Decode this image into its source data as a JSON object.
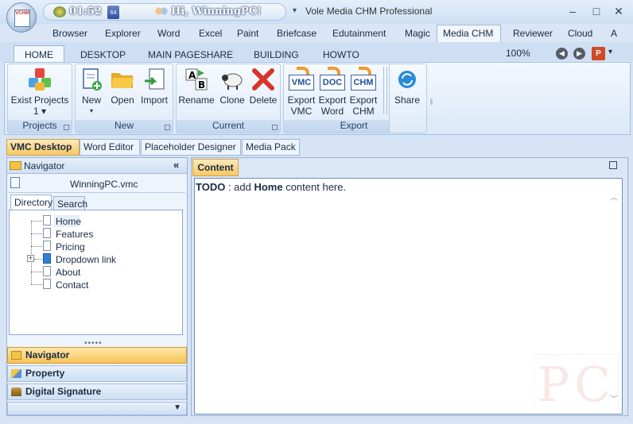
{
  "titlebar": {
    "time": "01:52",
    "user_greeting": "Hi, WinningPC!",
    "window_title": "Vole Media CHM Professional",
    "minimize": "–",
    "maximize": "□",
    "close": "✕",
    "logo_text": "VCHM"
  },
  "menu": {
    "items": [
      "Browser",
      "Explorer",
      "Word",
      "Excel",
      "Paint",
      "Briefcase",
      "Edutainment",
      "Magic",
      "Media CHM",
      "Reviewer",
      "Cloud",
      "A"
    ],
    "active": "Media CHM"
  },
  "ribbon_tabs": {
    "items": [
      "HOME",
      "DESKTOP",
      "MAIN PAGESHARE",
      "BUILDING",
      "HOWTO"
    ],
    "active": "HOME",
    "zoom": "100%"
  },
  "ribbon": {
    "groups": {
      "projects": {
        "label": "Projects",
        "exist_projects": "Exist Projects",
        "count": "1"
      },
      "new": {
        "label": "New",
        "new_label": "New",
        "open_label": "Open",
        "import_label": "Import"
      },
      "current": {
        "label": "Current",
        "rename_label": "Rename",
        "clone_label": "Clone",
        "delete_label": "Delete"
      },
      "export": {
        "label": "Export",
        "export_vmc": [
          "Export",
          "VMC"
        ],
        "export_word": [
          "Export",
          "Word"
        ],
        "export_chm": [
          "Export",
          "CHM"
        ],
        "icon_vmc": "VMC",
        "icon_doc": "DOC",
        "icon_chm": "CHM"
      },
      "share": {
        "share_label": "Share"
      }
    }
  },
  "doc_tabs": {
    "items": [
      "VMC Desktop",
      "Word Editor",
      "Placeholder Designer",
      "Media Pack"
    ],
    "active": "VMC Desktop"
  },
  "navigator": {
    "title": "Navigator",
    "collapse": "«",
    "project_name": "WinningPC.vmc",
    "subtabs": [
      "Directory",
      "Search"
    ],
    "tree": [
      "Home",
      "Features",
      "Pricing",
      "Dropdown link",
      "About",
      "Contact"
    ],
    "grip": "•••••",
    "accordion": [
      "Navigator",
      "Property",
      "Digital Signature"
    ]
  },
  "content": {
    "tab_label": "Content",
    "todo_prefix": "TODO",
    "todo_sep": " : add ",
    "todo_bold": "Home",
    "todo_suffix": " content here."
  },
  "watermark": "PC"
}
